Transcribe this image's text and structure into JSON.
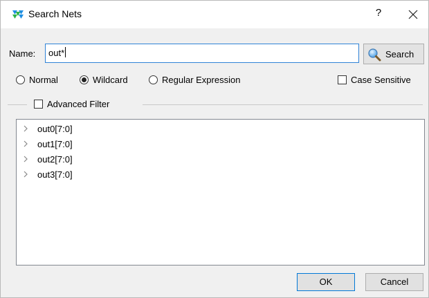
{
  "window": {
    "title": "Search Nets",
    "help_label": "?",
    "close_icon": "close-icon",
    "app_icon": "nets-app-icon"
  },
  "search": {
    "name_label": "Name:",
    "name_value": "out*",
    "search_button_label": "Search",
    "search_icon": "magnifier-icon"
  },
  "modes": {
    "options": [
      {
        "label": "Normal",
        "selected": false
      },
      {
        "label": "Wildcard",
        "selected": true
      },
      {
        "label": "Regular Expression",
        "selected": false
      }
    ],
    "case_sensitive_label": "Case Sensitive",
    "case_sensitive_checked": false
  },
  "advanced_filter": {
    "label": "Advanced Filter",
    "checked": false
  },
  "results": {
    "items": [
      {
        "label": "out0[7:0]"
      },
      {
        "label": "out1[7:0]"
      },
      {
        "label": "out2[7:0]"
      },
      {
        "label": "out3[7:0]"
      }
    ]
  },
  "buttons": {
    "ok_label": "OK",
    "cancel_label": "Cancel"
  },
  "colors": {
    "input_focus_border": "#2e82d6",
    "app_icon_blue": "#1f8fe3",
    "app_icon_green": "#2fb34a"
  }
}
